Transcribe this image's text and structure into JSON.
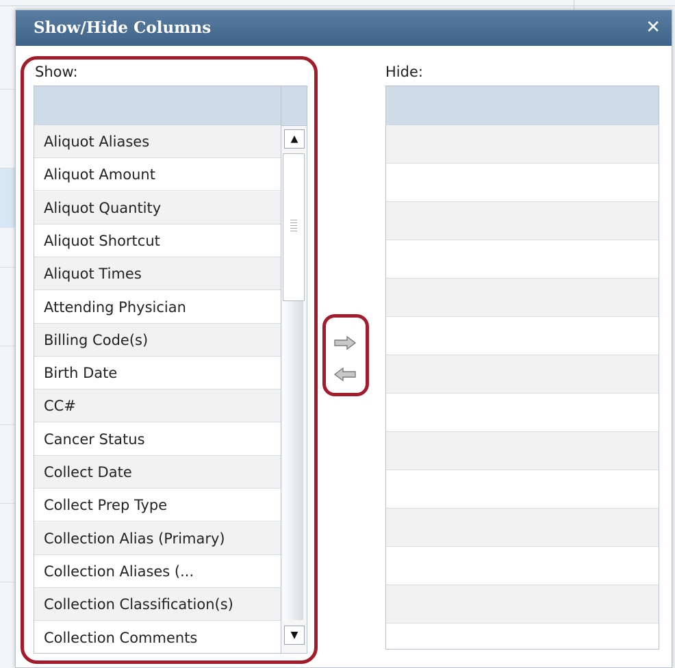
{
  "dialog": {
    "title": "Show/Hide Columns",
    "close_label": "✕"
  },
  "show_panel": {
    "label": "Show:",
    "items": [
      "Aliquot Aliases",
      "Aliquot Amount",
      "Aliquot Quantity",
      "Aliquot Shortcut",
      "Aliquot Times",
      "Attending Physician",
      "Billing Code(s)",
      "Birth Date",
      "CC#",
      "Cancer Status",
      "Collect Date",
      "Collect Prep Type",
      "Collection Alias (Primary)",
      "Collection Aliases (...",
      "Collection Classification(s)",
      "Collection Comments"
    ],
    "scroll_up": "▲",
    "scroll_down": "▼"
  },
  "hide_panel": {
    "label": "Hide:",
    "items": []
  },
  "colors": {
    "title_bar": "#4a6f95",
    "highlight": "#a11d2b",
    "header_fill": "#cfdbe6"
  }
}
